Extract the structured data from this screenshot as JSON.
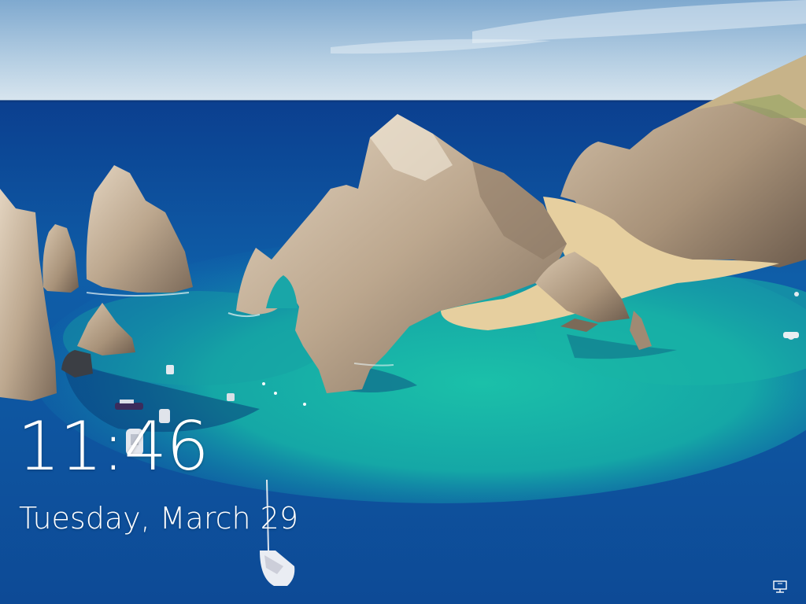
{
  "lock_screen": {
    "time": "11:46",
    "date": "Tuesday, March 29"
  },
  "status": {
    "network_icon": "network-ethernet-icon"
  },
  "colors": {
    "sky_top": "#8ab4d6",
    "sea_deep": "#0b4f9e",
    "sea_turquoise": "#19b3a4",
    "rock": "#c9b7a0",
    "sand": "#e8d2a6",
    "text": "#ffffff"
  }
}
